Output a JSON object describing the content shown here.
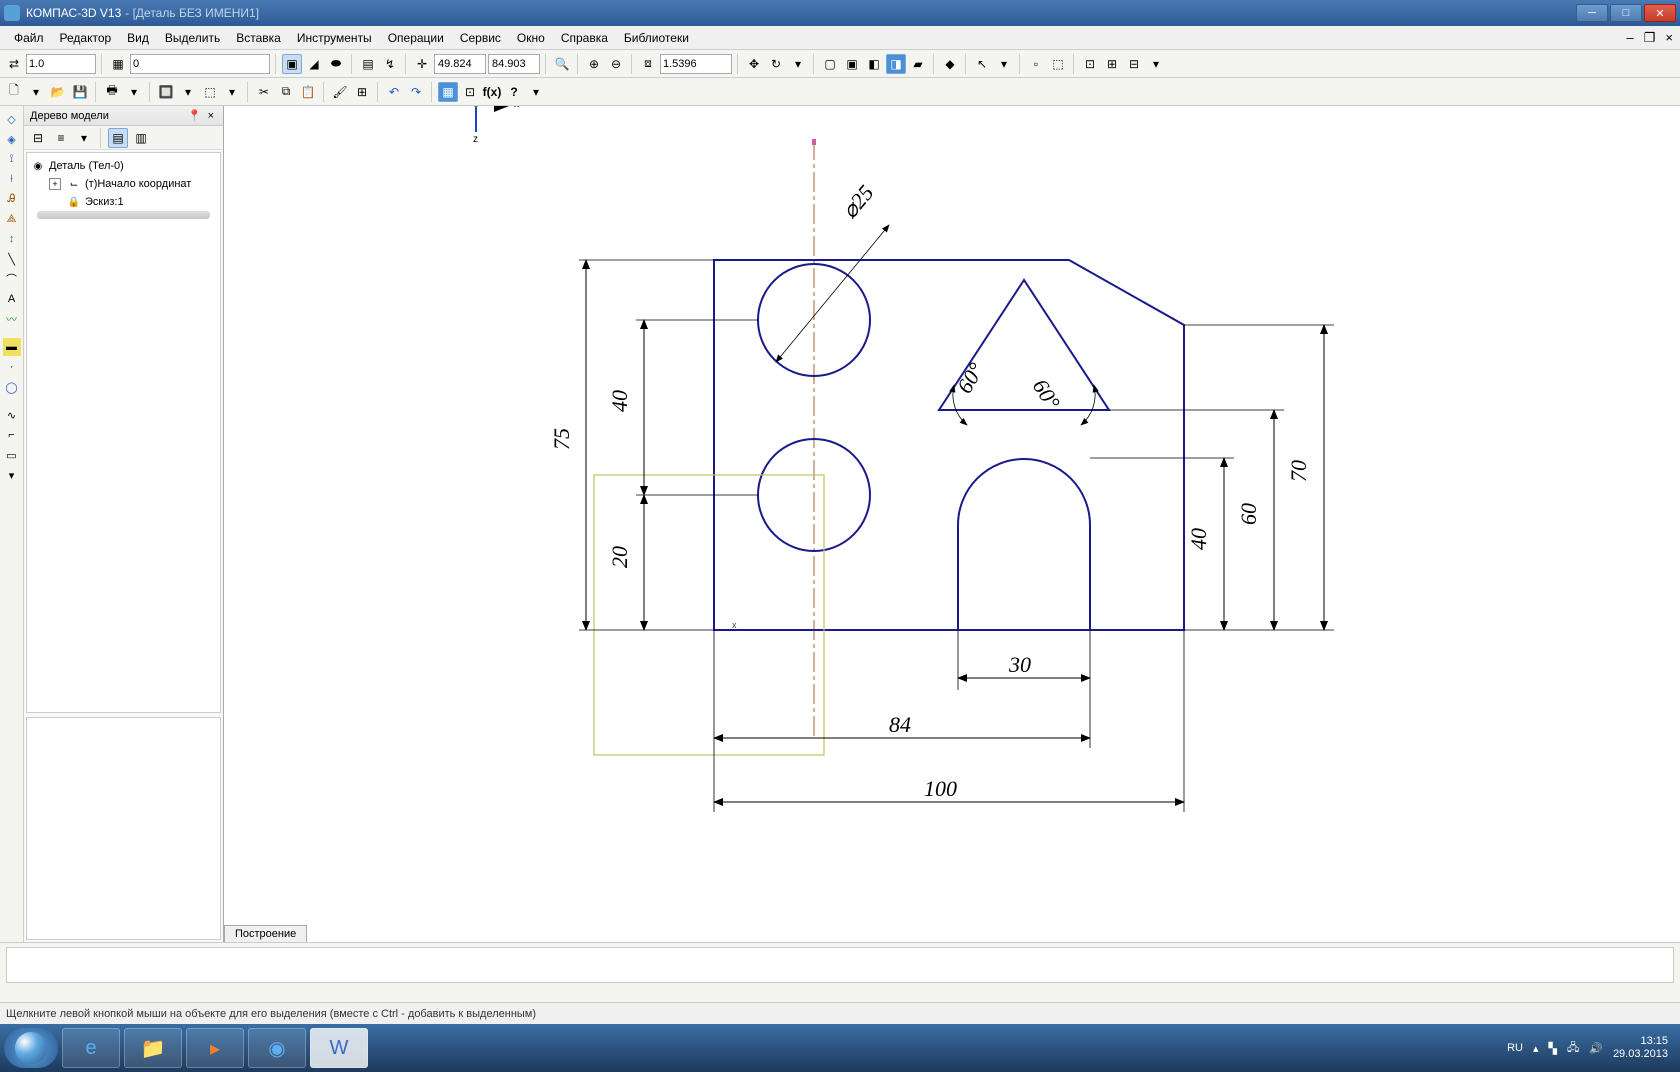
{
  "titlebar": {
    "app": "КОМПАС-3D V13",
    "doc": "- [Деталь БЕЗ ИМЕНИ1]"
  },
  "menubar": {
    "items": [
      "Файл",
      "Редактор",
      "Вид",
      "Выделить",
      "Вставка",
      "Инструменты",
      "Операции",
      "Сервис",
      "Окно",
      "Справка",
      "Библиотеки"
    ]
  },
  "toolbar1": {
    "step": "1.0",
    "layer": "0",
    "coord_x": "49.824",
    "coord_y": "84.903",
    "zoom": "1.5396"
  },
  "tree": {
    "title": "Дерево модели",
    "root": "Деталь (Тел-0)",
    "node1": "(т)Начало координат",
    "node2": "Эскиз:1"
  },
  "drawing": {
    "diameter": "⌀25",
    "dim_75": "75",
    "dim_40a": "40",
    "dim_20": "20",
    "dim_40b": "40",
    "dim_60": "60",
    "dim_70": "70",
    "dim_30": "30",
    "dim_84": "84",
    "dim_100": "100",
    "angle_60a": "60°",
    "angle_60b": "60°",
    "axis_x": "x",
    "axis_z": "z"
  },
  "bottom_tab": "Построение",
  "statusbar": {
    "hint": "Щелкните левой кнопкой мыши на объекте для его выделения (вместе с Ctrl - добавить к выделенным)"
  },
  "tray": {
    "lang": "RU",
    "time": "13:15",
    "date": "29.03.2013"
  }
}
